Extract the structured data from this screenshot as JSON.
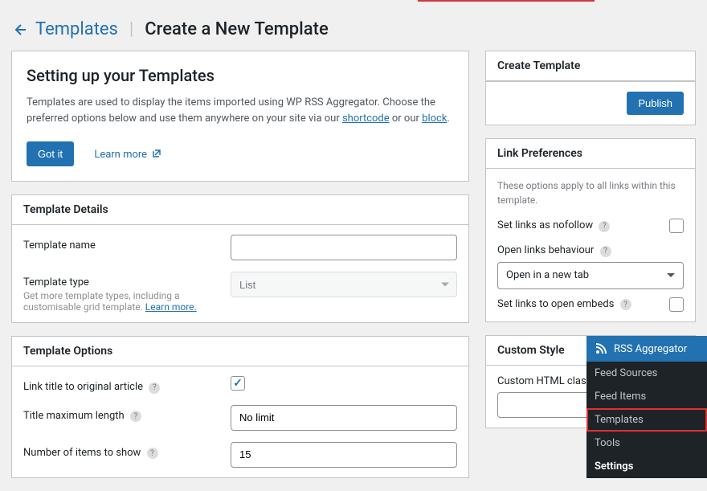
{
  "header": {
    "breadcrumb": "Templates",
    "title": "Create a New Template"
  },
  "intro": {
    "heading": "Setting up your Templates",
    "body_before_links": "Templates are used to display the items imported using WP RSS Aggregator. Choose the preferred options below and use them anywhere on your site via our ",
    "shortcode_link": "shortcode",
    "body_mid": " or our ",
    "block_link": "block",
    "body_after": ".",
    "got_it": "Got it",
    "learn_more": "Learn more"
  },
  "details": {
    "panel_title": "Template Details",
    "name_label": "Template name",
    "name_value": "",
    "type_label": "Template type",
    "type_help_before": "Get more template types, including a customisable grid template. ",
    "type_learn_more": "Learn more.",
    "type_value": "List"
  },
  "options": {
    "panel_title": "Template Options",
    "link_title_label": "Link title to original article",
    "link_title_checked": true,
    "title_max_label": "Title maximum length",
    "title_max_value": "No limit",
    "num_items_label": "Number of items to show",
    "num_items_value": "15"
  },
  "sidebar": {
    "create": {
      "panel_title": "Create Template",
      "publish": "Publish"
    },
    "link_prefs": {
      "panel_title": "Link Preferences",
      "intro": "These options apply to all links within this template.",
      "nofollow_label": "Set links as nofollow",
      "behaviour_label": "Open links behaviour",
      "behaviour_value": "Open in a new tab",
      "embeds_label": "Set links to open embeds"
    },
    "custom_style": {
      "panel_title": "Custom Style",
      "class_label": "Custom HTML class"
    }
  },
  "admin_menu": {
    "title": "RSS Aggregator",
    "items": {
      "feed_sources": "Feed Sources",
      "feed_items": "Feed Items",
      "templates": "Templates",
      "tools": "Tools",
      "settings": "Settings"
    }
  }
}
